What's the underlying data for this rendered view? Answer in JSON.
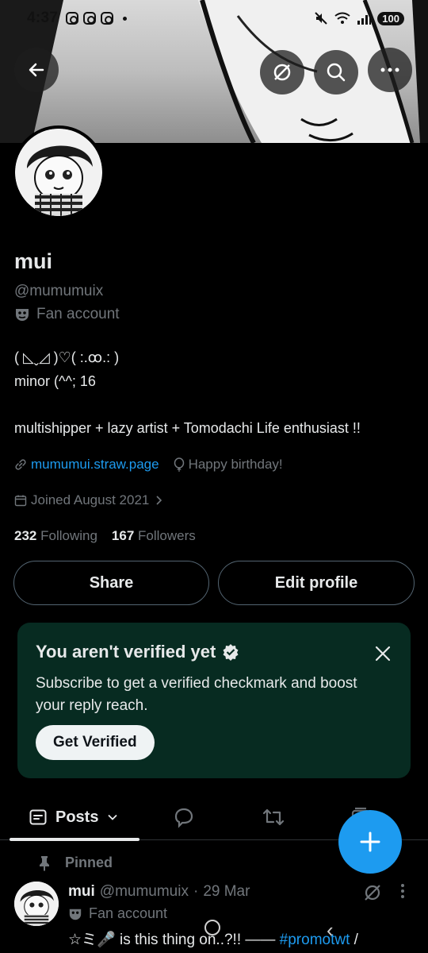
{
  "status_bar": {
    "time": "4:37",
    "battery": "100"
  },
  "profile": {
    "display_name": "mui",
    "handle": "@mumumuix",
    "account_label": "Fan account",
    "bio_line1": "( ◺ˬ◿ )♡( :.ꝏ.: )",
    "bio_line2": "minor (^^; 16",
    "bio_line3": "multishipper + lazy artist + Tomodachi Life enthusiast !!",
    "link": "mumumui.straw.page",
    "birthday": "Happy birthday!",
    "joined": "Joined August 2021",
    "following_count": "232",
    "following_label": "Following",
    "followers_count": "167",
    "followers_label": "Followers"
  },
  "actions": {
    "share": "Share",
    "edit_profile": "Edit profile"
  },
  "verify_card": {
    "title": "You aren't verified yet",
    "text": "Subscribe to get a verified checkmark and boost your reply reach.",
    "button": "Get Verified"
  },
  "tabs": {
    "posts": "Posts"
  },
  "pinned_post": {
    "pinned_label": "Pinned",
    "name": "mui",
    "handle": "@mumumuix",
    "separator": "·",
    "date": "29 Mar",
    "account_label": "Fan account",
    "body_prefix": "☆ミ🎤 is this thing on..?!! —— ",
    "hashtag": "#promotwt",
    "body_suffix": " /"
  },
  "colors": {
    "accent": "#1d9bf0",
    "verify_bg": "#072b21",
    "muted": "#71767b"
  },
  "icons": [
    "back-arrow-icon",
    "grok-icon",
    "search-icon",
    "more-icon",
    "fan-mask-icon",
    "link-icon",
    "balloon-icon",
    "calendar-icon",
    "verified-badge-icon",
    "close-icon",
    "posts-icon",
    "reply-icon",
    "repost-icon",
    "media-icon",
    "plus-icon",
    "pin-icon"
  ]
}
